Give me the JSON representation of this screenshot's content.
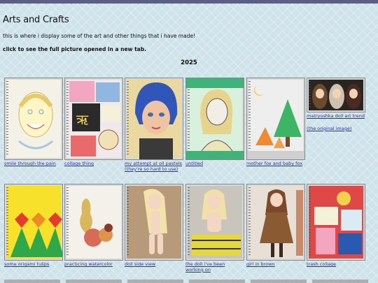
{
  "page": {
    "title": "Arts and Crafts",
    "intro": "this is where i display some of the art and other things that i have made!",
    "note": "click to see the full picture opened in a new tab.",
    "year": "2025"
  },
  "row1": [
    {
      "caption": "smile through the pain"
    },
    {
      "caption": "collage thing"
    },
    {
      "caption": "my attempt at oil pastels (they're so hard to use)"
    },
    {
      "caption": "untitled"
    },
    {
      "caption": "mother fox and baby fox"
    },
    {
      "caption": "matryoshka doll art trend",
      "extra": "(the original image)"
    }
  ],
  "row2": [
    {
      "caption": "some origami tulips"
    },
    {
      "caption": "practicing watercolor"
    },
    {
      "caption": "doll side view"
    },
    {
      "caption": "the doll i've been working on"
    },
    {
      "caption": "girl in brown"
    },
    {
      "caption": "trash collage"
    }
  ],
  "colors": {
    "band": "#5b5f86",
    "link": "#2b2bb8",
    "background": "#cfe3ea"
  }
}
